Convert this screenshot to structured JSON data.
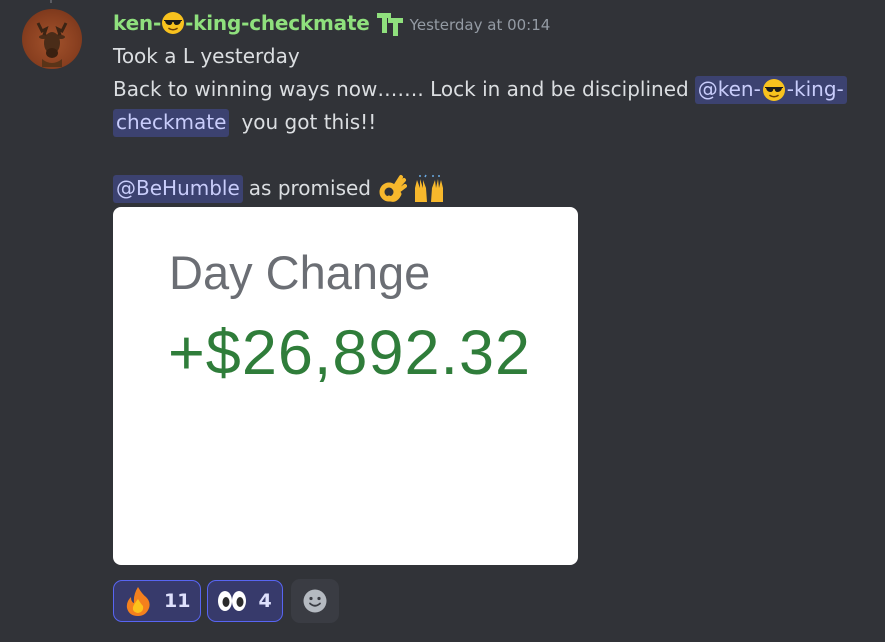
{
  "message": {
    "author": {
      "name_prefix": "ken-",
      "name_suffix": "-king-checkmate",
      "name_emoji": "sunglasses-emoji",
      "role_icon": "tt-role-icon",
      "name_color": "#8fe07d"
    },
    "timestamp": "Yesterday at 00:14",
    "lines": {
      "line1": "Took a L yesterday",
      "line2_text": "Back to winning ways now……. Lock in and be disciplined",
      "mention1_prefix": "@ken-",
      "mention1_suffix": "-king-",
      "mention1_cont": "checkmate",
      "line3_after": "you got this!!",
      "mention2": "@BeHumble",
      "line5_after": "as promised",
      "line5_emojis": [
        "ok-hand-emoji",
        "raised-hands-emoji"
      ]
    },
    "attachment": {
      "label": "Day Change",
      "value": "+$26,892.32",
      "value_color": "#2f7d3a"
    },
    "reactions": [
      {
        "emoji": "fire-emoji",
        "count": "11"
      },
      {
        "emoji": "eyes-emoji",
        "count": "4"
      }
    ],
    "add_reaction_icon": "add-reaction-icon"
  }
}
